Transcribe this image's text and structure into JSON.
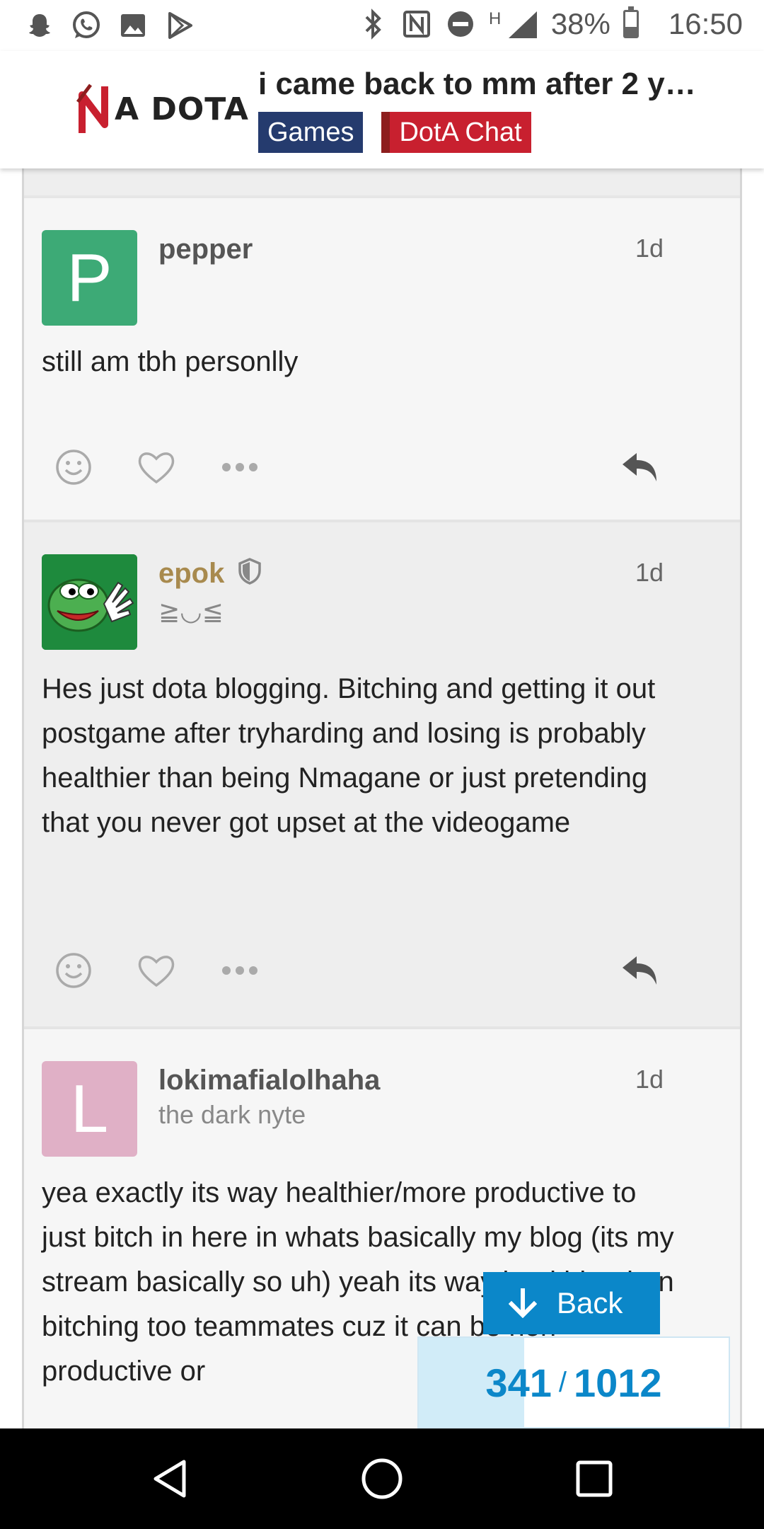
{
  "status_bar": {
    "battery_text": "38%",
    "battery_level": 0.38,
    "network_type": "H",
    "time": "16:50",
    "left_icons": [
      "snapchat-icon",
      "whatsapp-icon",
      "gallery-icon",
      "play-store-icon"
    ],
    "right_icons": [
      "bluetooth-icon",
      "nfc-icon",
      "do-not-disturb-icon",
      "signal-icon",
      "battery-icon"
    ]
  },
  "header": {
    "logo_text": "A DOTA",
    "topic_title": "i came back to mm after 2 y…",
    "tags": [
      "Games",
      "DotA Chat"
    ],
    "colors": {
      "games_tag": "#253b6e",
      "dota_tag": "#c8202f"
    }
  },
  "posts": [
    {
      "avatar_letter": "P",
      "avatar_color": "#3daa76",
      "username": "pepper",
      "user_title": "",
      "date": "1d",
      "body": "still am tbh personlly"
    },
    {
      "avatar_letter": "",
      "avatar_color": "#1e8a3d",
      "username": "epok",
      "user_title": "≧◡≦",
      "date": "1d",
      "moderator": true,
      "body": "Hes just dota blogging. Bitching and getting it out postgame after tryharding and losing is probably healthier than being Nmagane or just pretending that you never got upset at the videogame"
    },
    {
      "avatar_letter": "L",
      "avatar_color": "#e0b0c6",
      "username": "lokimafialolhaha",
      "user_title": "the dark nyte",
      "date": "1d",
      "body": "yea exactly its way healthier/more productive to just bitch in here in whats basically my blog (its my stream basically so uh) yeah its way healthier than bitching too teammates cuz it can be non-productive or"
    }
  ],
  "back_button": {
    "label": "Back"
  },
  "progress": {
    "current": "341",
    "total": "1012",
    "separator": "/",
    "fraction": 0.34
  },
  "nav_bar": {
    "buttons": [
      "back",
      "home",
      "recents"
    ]
  }
}
